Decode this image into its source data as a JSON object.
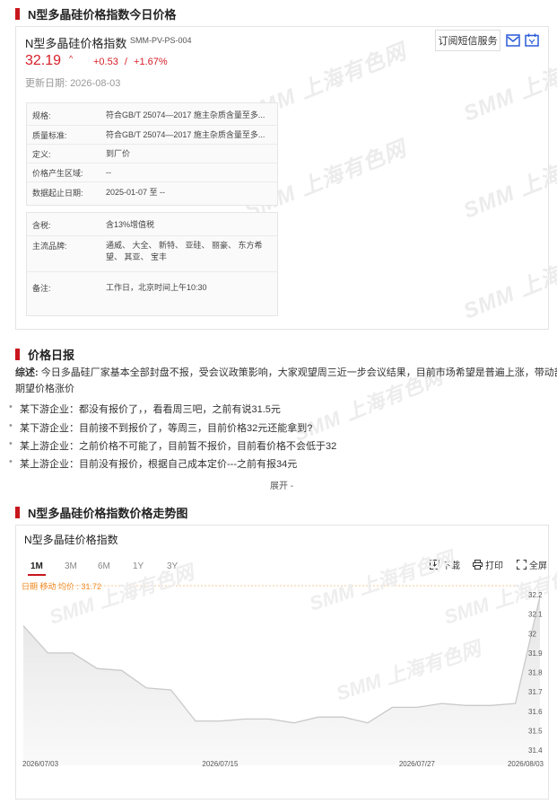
{
  "section1": {
    "title": "N型多晶硅价格指数今日价格",
    "product_name": "N型多晶硅价格指数",
    "product_code": "SMM-PV-PS-004",
    "price": "32.19",
    "change": "+0.53",
    "change_sep": "/",
    "change_pct": "+1.67%",
    "update_label": "更新日期:",
    "update_date": "2026-08-03",
    "subscribe_label": "订阅短信服务",
    "info1": [
      {
        "k": "规格:",
        "v": "符合GB/T 25074—2017 施主杂质含量至多..."
      },
      {
        "k": "质量标准:",
        "v": "符合GB/T 25074—2017 施主杂质含量至多..."
      },
      {
        "k": "定义:",
        "v": "到厂价"
      },
      {
        "k": "价格产生区域:",
        "v": "--"
      },
      {
        "k": "数据起止日期:",
        "v": "2025-01-07 至 --"
      }
    ],
    "info2": [
      {
        "k": "含税:",
        "v": "含13%增值税"
      },
      {
        "k": "主流品牌:",
        "v": "通威、 大全、 新特、 亚硅、 丽豪、 东方希望、 其亚、 宝丰"
      },
      {
        "k": "备注:",
        "v": "工作日，北京时间上午10:30"
      }
    ]
  },
  "section2": {
    "title": "价格日报",
    "summary_label": "综述:",
    "summary_line1": " 今日多晶硅厂家基本全部封盘不报，受会议政策影响，大家观望周三近一步会议结果，目前市场希望是普遍上涨，带动部分",
    "summary_line2": "期望价格涨价",
    "bullets": [
      "某下游企业：都没有报价了，，看看周三吧，之前有说31.5元",
      "某下游企业：目前接不到报价了，等周三，目前价格32元还能拿到?",
      "某上游企业：之前价格不可能了，目前暂不报价，目前看价格不会低于32",
      "某上游企业：目前没有报价，根据自己成本定价---之前有报34元"
    ],
    "expand_label": "展开 -"
  },
  "section3": {
    "title": "N型多晶硅价格指数价格走势图",
    "chart_title": "N型多晶硅价格指数",
    "tabs": [
      "1M",
      "3M",
      "6M",
      "1Y",
      "3Y"
    ],
    "active_tab": "1M",
    "tools": {
      "download": "下载",
      "print": "打印",
      "fullscreen": "全屏"
    },
    "avg_label": "日期 移动 均价 : 31.72"
  },
  "watermark": {
    "brand": "SMM",
    "cn": "上海有色网"
  },
  "colors": {
    "accent": "#c8161d",
    "up": "#d61e28",
    "line": "#c9c9c9",
    "area_top": "#e6e6e6",
    "icon_blue": "#2a5bd7"
  },
  "chart_data": {
    "type": "area",
    "title": "N型多晶硅价格指数",
    "x": [
      "2026/07/03",
      "2026/07/06",
      "2026/07/07",
      "2026/07/08",
      "2026/07/09",
      "2026/07/10",
      "2026/07/13",
      "2026/07/14",
      "2026/07/15",
      "2026/07/16",
      "2026/07/17",
      "2026/07/20",
      "2026/07/21",
      "2026/07/22",
      "2026/07/23",
      "2026/07/24",
      "2026/07/27",
      "2026/07/28",
      "2026/07/29",
      "2026/07/30",
      "2026/07/31",
      "2026/08/03"
    ],
    "x_tick_labels": [
      "2026/07/03",
      "2026/07/15",
      "2026/07/27",
      "2026/08/03"
    ],
    "y": [
      32.04,
      31.9,
      31.9,
      31.82,
      31.81,
      31.72,
      31.71,
      31.55,
      31.55,
      31.56,
      31.56,
      31.54,
      31.57,
      31.57,
      31.54,
      31.62,
      31.62,
      31.64,
      31.63,
      31.63,
      31.64,
      32.19
    ],
    "ylim": [
      31.4,
      32.2
    ],
    "y_ticks": [
      31.4,
      31.5,
      31.6,
      31.7,
      31.8,
      31.9,
      32.0,
      32.1,
      32.2
    ],
    "y_tick_labels": [
      "31.4",
      "31.5",
      "31.6",
      "31.7",
      "31.8",
      "31.9",
      "32",
      "32.1",
      "32.2"
    ],
    "grid": false
  }
}
